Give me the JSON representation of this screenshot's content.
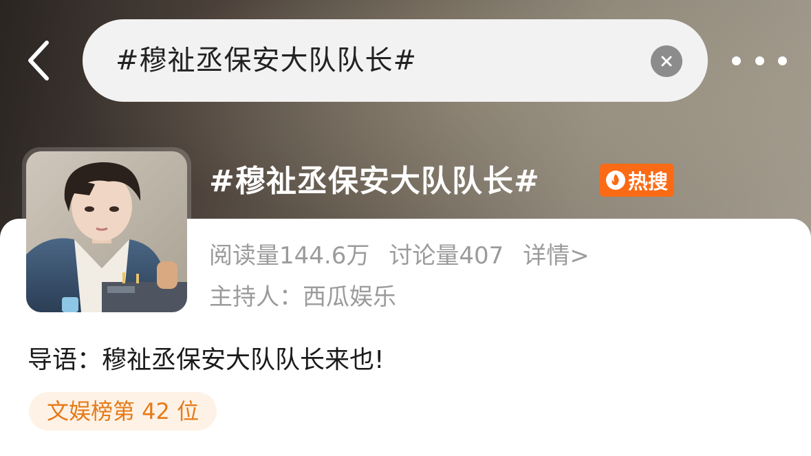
{
  "search": {
    "query": "#穆祉丞保安大队队长#"
  },
  "topic": {
    "title": "#穆祉丞保安大队队长#",
    "hot_badge": "热搜",
    "read_label": "阅读量",
    "read_count": "144.6万",
    "discuss_label": "讨论量",
    "discuss_count": "407",
    "detail_link": "详情>",
    "host_label": "主持人：",
    "host_name": "西瓜娱乐",
    "lead_label": "导语：",
    "lead_text": "穆祉丞保安大队队长来也!",
    "rank": "文娱榜第 42 位"
  },
  "colors": {
    "hot_badge": "#fb6a14",
    "rank_text": "#e57a17",
    "rank_bg": "#fef2e6",
    "meta_text": "#9b9b9b"
  },
  "icons": {
    "back": "chevron-left-icon",
    "clear": "close-icon",
    "more": "more-dots-icon",
    "hot": "fire-icon"
  }
}
